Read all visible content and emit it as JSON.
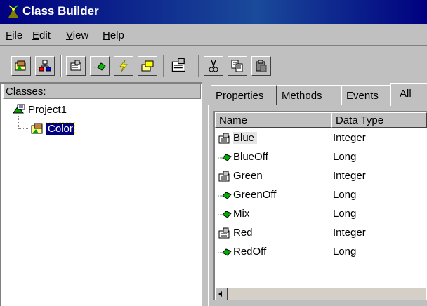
{
  "window": {
    "title": "Class Builder"
  },
  "menu": [
    {
      "label": "File",
      "accel": "F",
      "rest": "ile"
    },
    {
      "label": "Edit",
      "accel": "E",
      "rest": "dit"
    },
    {
      "label": "View",
      "accel": "V",
      "rest": "iew"
    },
    {
      "label": "Help",
      "accel": "H",
      "rest": "elp"
    }
  ],
  "toolbar": {
    "buttons": [
      "new-class-icon",
      "new-collection-icon",
      "add-property-icon",
      "add-method-icon",
      "add-event-icon",
      "add-enum-icon",
      "properties-icon",
      "cut-icon",
      "copy-icon",
      "paste-icon"
    ]
  },
  "left": {
    "header": "Classes:",
    "tree": [
      {
        "label": "Project1",
        "icon": "project-icon"
      },
      {
        "label": "Color",
        "icon": "class-icon",
        "selected": true
      }
    ]
  },
  "tabs": [
    {
      "label": "Properties",
      "accel": "P",
      "rest": "roperties"
    },
    {
      "label": "Methods",
      "accel": "M",
      "rest": "ethods"
    },
    {
      "label": "Events",
      "pre": "Eve",
      "accel": "n",
      "rest": "ts"
    },
    {
      "label": "All",
      "accel": "A",
      "rest": "ll",
      "active": true
    }
  ],
  "list": {
    "columns": [
      "Name",
      "Data Type"
    ],
    "rows": [
      {
        "name": "Blue",
        "type": "Integer",
        "kind": "property"
      },
      {
        "name": "BlueOff",
        "type": "Long",
        "kind": "method"
      },
      {
        "name": "Green",
        "type": "Integer",
        "kind": "property"
      },
      {
        "name": "GreenOff",
        "type": "Long",
        "kind": "method"
      },
      {
        "name": "Mix",
        "type": "Long",
        "kind": "method"
      },
      {
        "name": "Red",
        "type": "Integer",
        "kind": "property"
      },
      {
        "name": "RedOff",
        "type": "Long",
        "kind": "method"
      }
    ]
  },
  "colors": {
    "titlebar": "#000080",
    "selection": "#000080",
    "face": "#c0c0c0"
  }
}
